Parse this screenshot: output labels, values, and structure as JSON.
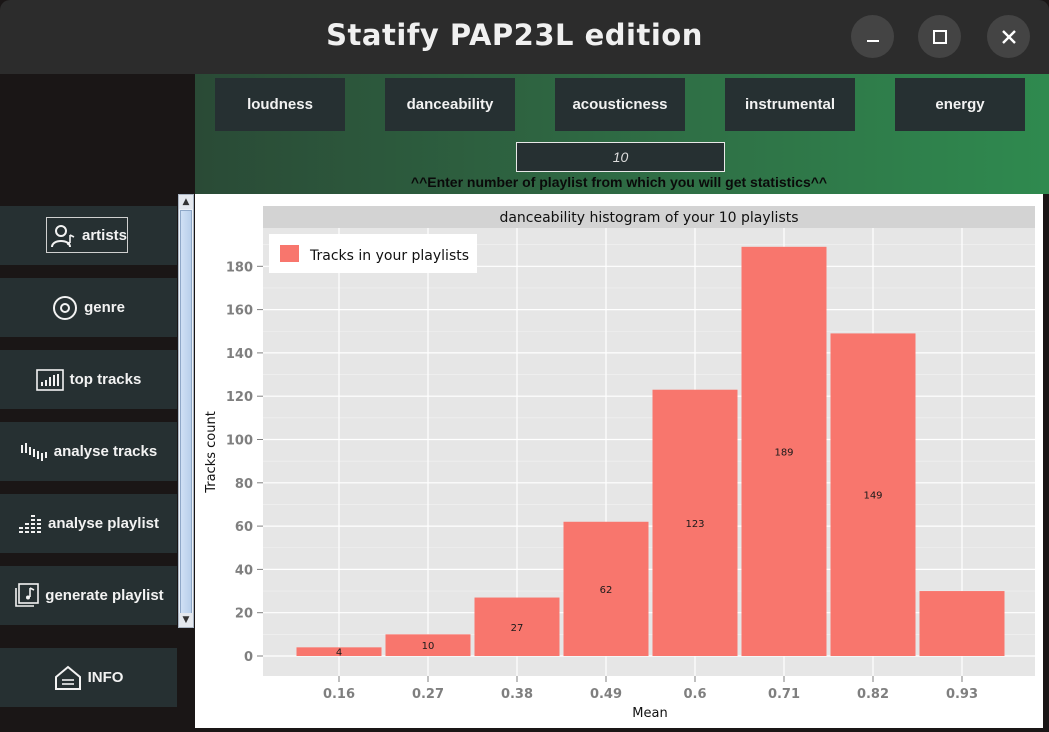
{
  "window": {
    "title": "Statify PAP23L edition",
    "controls": [
      "minimize-icon",
      "maximize-icon",
      "close-icon"
    ]
  },
  "top_tabs": [
    {
      "label": "loudness"
    },
    {
      "label": "danceability"
    },
    {
      "label": "acousticness"
    },
    {
      "label": "instrumental"
    },
    {
      "label": "energy"
    }
  ],
  "playlist_input": {
    "value": "10",
    "hint": "^^Enter number of playlist from which you will get statistics^^"
  },
  "sidebar": {
    "items": [
      {
        "label": "artists",
        "icon": "user-music-icon"
      },
      {
        "label": "genre",
        "icon": "disc-icon"
      },
      {
        "label": "top tracks",
        "icon": "bars-chart-icon"
      },
      {
        "label": "analyse tracks",
        "icon": "waveform-icon"
      },
      {
        "label": "analyse playlist",
        "icon": "equalizer-icon"
      },
      {
        "label": "generate playlist",
        "icon": "playlist-music-icon"
      }
    ],
    "info": {
      "label": "INFO",
      "icon": "home-icon"
    }
  },
  "colors": {
    "bar": "#f8766d",
    "panel": "#263032",
    "green_accent": "#2f8a4f"
  },
  "chart_data": {
    "type": "bar",
    "title": "danceability histogram of your 10 playlists",
    "xlabel": "Mean",
    "ylabel": "Tracks count",
    "categories": [
      "0.16",
      "0.27",
      "0.38",
      "0.49",
      "0.6",
      "0.71",
      "0.82",
      "0.93"
    ],
    "series": [
      {
        "name": "Tracks in your playlists",
        "values": [
          4,
          10,
          27,
          62,
          123,
          189,
          149,
          30
        ]
      }
    ],
    "bar_labels": [
      "4",
      "10",
      "27",
      "62",
      "123",
      "189",
      "149",
      ""
    ],
    "yticks": [
      "0",
      "20",
      "40",
      "60",
      "80",
      "100",
      "120",
      "140",
      "160",
      "180"
    ],
    "ylim": [
      0,
      195
    ],
    "grid": true,
    "legend_position": "top-left"
  }
}
